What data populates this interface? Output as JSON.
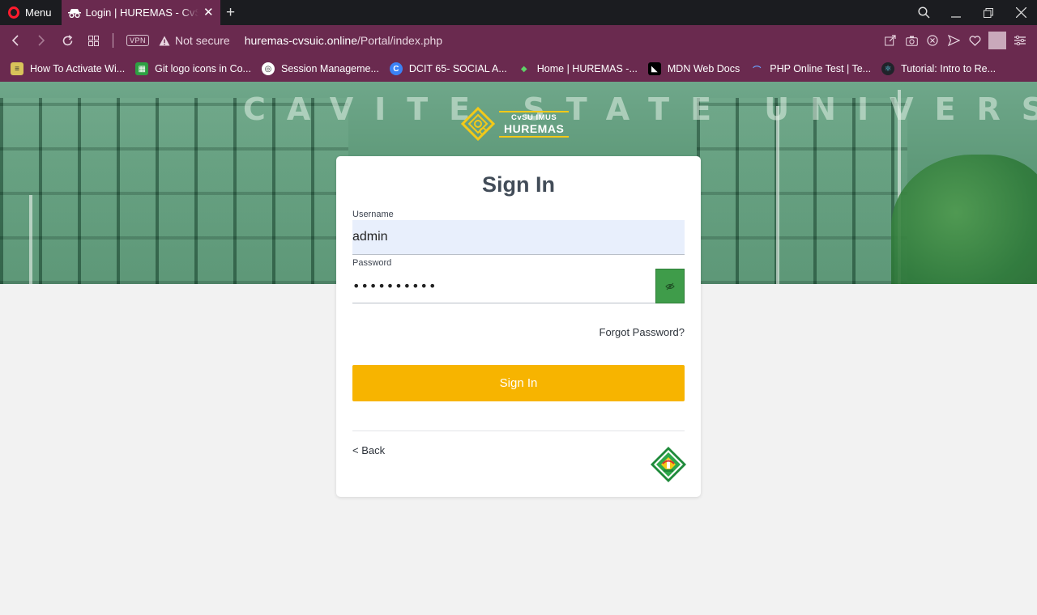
{
  "browser": {
    "menu_label": "Menu",
    "tab_title": "Login | HUREMAS - CvSU Imus",
    "vpn_label": "VPN",
    "security_label": "Not secure",
    "url_host": "huremas-cvsuic.online",
    "url_path": "/Portal/index.php"
  },
  "bookmarks": [
    {
      "label": "How To Activate Wi...",
      "icon": "bookmark-folder-icon",
      "color": "#d8c35a"
    },
    {
      "label": "Git logo icons in Co...",
      "icon": "git-icon",
      "color": "#2ea043"
    },
    {
      "label": "Session Manageme...",
      "icon": "session-icon",
      "color": "#ffffff"
    },
    {
      "label": "DCIT 65- SOCIAL A...",
      "icon": "canva-icon",
      "color": "#3b82f6"
    },
    {
      "label": "Home | HUREMAS -...",
      "icon": "huremas-icon",
      "color": "#2f9e44"
    },
    {
      "label": "MDN Web Docs",
      "icon": "mdn-icon",
      "color": "#000000"
    },
    {
      "label": "PHP Online Test | Te...",
      "icon": "php-test-icon",
      "color": "#3b82f6"
    },
    {
      "label": "Tutorial: Intro to Re...",
      "icon": "react-icon",
      "color": "#61dafb"
    }
  ],
  "hero": {
    "facade_text": "CAVITE STATE UNIVERSITY - IMUS",
    "logo_line1": "CvSU IMUS",
    "logo_line2": "HUREMAS"
  },
  "login": {
    "title": "Sign In",
    "username_label": "Username",
    "username_value": "admin",
    "password_label": "Password",
    "password_value": "••••••••••",
    "forgot_label": "Forgot Password?",
    "submit_label": "Sign In",
    "back_label": "< Back"
  },
  "colors": {
    "chrome": "#6a2a4f",
    "accent_button": "#f7b400",
    "eye_button": "#3f9c4a",
    "username_bg": "#e8effc"
  }
}
